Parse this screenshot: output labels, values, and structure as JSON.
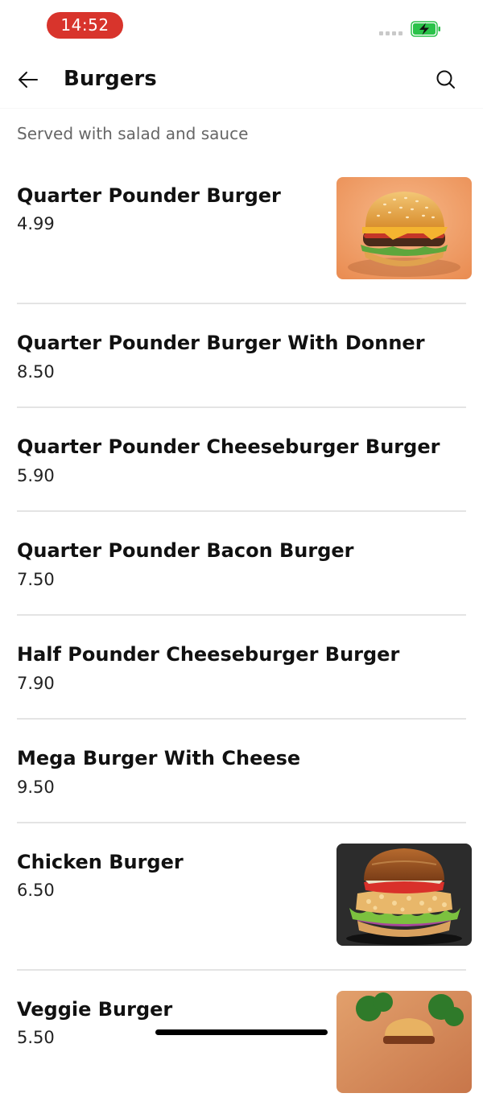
{
  "status_bar": {
    "time": "14:52",
    "time_pill_color": "#d8342c",
    "battery_color": "#2bc24a",
    "battery_state": "charging"
  },
  "header": {
    "title": "Burgers",
    "back_icon": "arrow-left-icon",
    "search_icon": "search-icon"
  },
  "category": {
    "description": "Served with salad and sauce"
  },
  "items": [
    {
      "name": "Quarter Pounder Burger",
      "price": "4.99",
      "has_image": true,
      "image": "cheeseburger-photo"
    },
    {
      "name": "Quarter Pounder Burger With Donner",
      "price": "8.50",
      "has_image": false
    },
    {
      "name": "Quarter Pounder Cheeseburger Burger",
      "price": "5.90",
      "has_image": false
    },
    {
      "name": "Quarter Pounder Bacon Burger",
      "price": "7.50",
      "has_image": false
    },
    {
      "name": "Half Pounder Cheeseburger Burger",
      "price": "7.90",
      "has_image": false
    },
    {
      "name": "Mega Burger With Cheese",
      "price": "9.50",
      "has_image": false
    },
    {
      "name": "Chicken Burger",
      "price": "6.50",
      "has_image": true,
      "image": "chicken-burger-photo"
    },
    {
      "name": "Veggie Burger",
      "price": "5.50",
      "has_image": true,
      "image": "veggie-burger-photo"
    }
  ]
}
